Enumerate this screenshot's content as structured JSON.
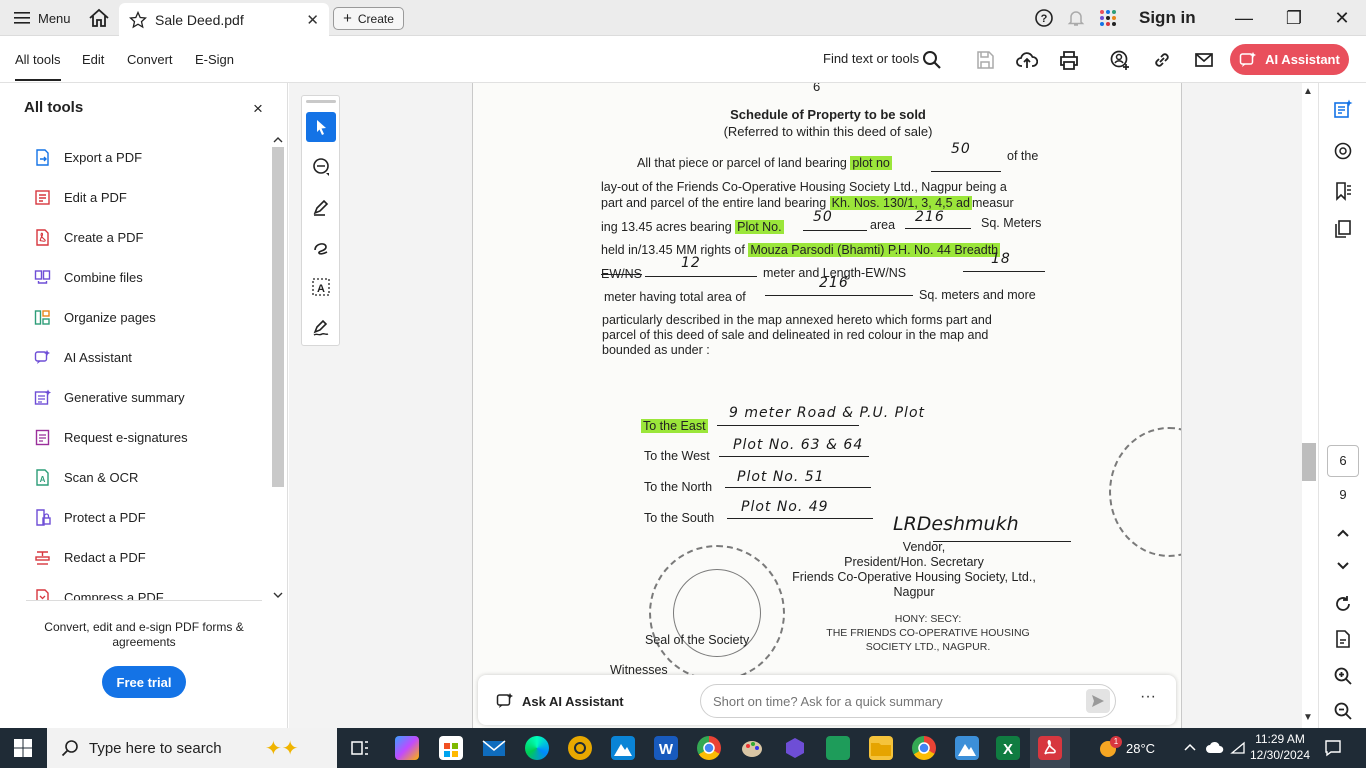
{
  "titlebar": {
    "menu_label": "Menu",
    "tab_title": "Sale Deed.pdf",
    "tab_close": "✕",
    "create_label": "Create",
    "signin_label": "Sign in"
  },
  "toolbar": {
    "menus": [
      "All tools",
      "Edit",
      "Convert",
      "E-Sign"
    ],
    "find_label": "Find text or tools",
    "ai_assistant_label": "AI Assistant"
  },
  "left_panel": {
    "title": "All tools",
    "close": "×",
    "items": [
      {
        "label": "Export a PDF",
        "icon": "export-pdf-icon",
        "color": "#1473e6"
      },
      {
        "label": "Edit a PDF",
        "icon": "edit-pdf-icon",
        "color": "#d7373f"
      },
      {
        "label": "Create a PDF",
        "icon": "create-pdf-icon",
        "color": "#d7373f"
      },
      {
        "label": "Combine files",
        "icon": "combine-files-icon",
        "color": "#6e4ed6"
      },
      {
        "label": "Organize pages",
        "icon": "organize-pages-icon",
        "color": "#2d9d78"
      },
      {
        "label": "AI Assistant",
        "icon": "ai-assistant-icon",
        "color": "#6e4ed6"
      },
      {
        "label": "Generative summary",
        "icon": "generative-summary-icon",
        "color": "#6e4ed6"
      },
      {
        "label": "Request e-signatures",
        "icon": "request-esign-icon",
        "color": "#9b2f9b"
      },
      {
        "label": "Scan & OCR",
        "icon": "scan-ocr-icon",
        "color": "#2d9d78"
      },
      {
        "label": "Protect a PDF",
        "icon": "protect-pdf-icon",
        "color": "#6e4ed6"
      },
      {
        "label": "Redact a PDF",
        "icon": "redact-pdf-icon",
        "color": "#d7373f"
      },
      {
        "label": "Compress a PDF",
        "icon": "compress-pdf-icon",
        "color": "#d7373f"
      }
    ],
    "promo_text": "Convert, edit and e-sign PDF forms & agreements",
    "trial_label": "Free trial"
  },
  "document": {
    "page_number_top": "6",
    "title": "Schedule of Property to be sold",
    "subtitle": "(Referred to within this deed of sale)",
    "lines": {
      "l1a": "All that piece or parcel of land bearing",
      "l1hl": "plot no",
      "l1b": "of the",
      "l2": "lay-out of the Friends Co-Operative Housing Society Ltd., Nagpur being a",
      "l3a": "part and parcel of the entire land bearing",
      "l3hl": "Kh. Nos. 130/1, 3, 4,5 ad",
      "l3b": "measur",
      "l4a": "ing 13.45 acres bearing",
      "l4hl": "Plot No.",
      "l4b": "area",
      "l4c": "Sq. Meters",
      "l5a": "held in/13.45 MM rights of",
      "l5hl": "Mouza Parsodi (Bhamti) P.H. No. 44 Breadth",
      "l6a": "EW/NS",
      "l6b": "meter and Length-EW/NS",
      "l7a": "meter having total area of",
      "l7b": "Sq. meters and more",
      "l8": "particularly described in the map annexed hereto which forms part and",
      "l9": "parcel of this deed of sale and delineated in red colour in the  map  and",
      "l10": "bounded as under :"
    },
    "handwritten": {
      "plot_no": "50",
      "plot_no_2": "50",
      "area": "216",
      "breadth": "12",
      "length": "18",
      "total_area": "216"
    },
    "boundaries": [
      {
        "label": "To the East",
        "value": "9 meter Road & P.U. Plot"
      },
      {
        "label": "To the West",
        "value": "Plot No. 63 & 64"
      },
      {
        "label": "To the North",
        "value": "Plot No. 51"
      },
      {
        "label": "To the South",
        "value": "Plot No. 49"
      }
    ],
    "signature_text": "LRDeshmukh",
    "vendor_block": [
      "Vendor,",
      "President/Hon. Secretary",
      "Friends Co-Operative Housing Society, Ltd.,",
      "Nagpur"
    ],
    "stamp_block": [
      "HONY: SECY:",
      "THE FRIENDS CO-OPERATIVE HOUSING",
      "SOCIETY LTD., NAGPUR."
    ],
    "seal_label": "Seal of the Society",
    "witnesses_label": "Witnesses"
  },
  "ask_bar": {
    "label": "Ask AI Assistant",
    "placeholder": "Short on time? Ask for a quick summary",
    "more": "···"
  },
  "page_nav": {
    "current": "6",
    "total": "9"
  },
  "taskbar": {
    "search_placeholder": "Type here to search",
    "temperature": "28°C",
    "weather_badge": "1",
    "time": "11:29 AM",
    "date": "12/30/2024"
  },
  "colors": {
    "accent_blue": "#1473e6",
    "ai_red": "#e94f5c",
    "highlight_green": "#9be63a",
    "taskbar": "#1f2b36"
  }
}
